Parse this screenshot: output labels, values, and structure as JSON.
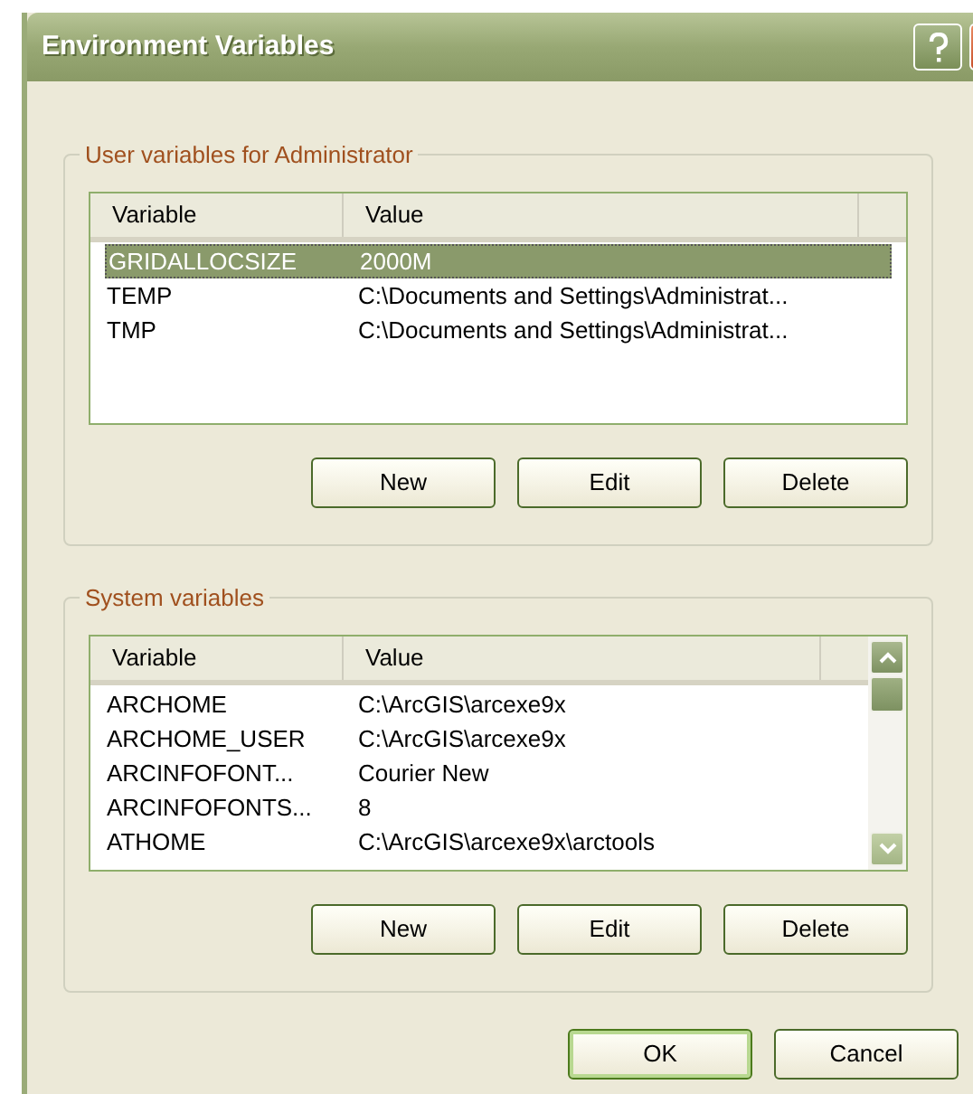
{
  "window": {
    "title": "Environment Variables"
  },
  "user_variables": {
    "label": "User variables for Administrator",
    "columns": [
      "Variable",
      "Value"
    ],
    "rows": [
      {
        "variable": "GRIDALLOCSIZE",
        "value": "2000M",
        "selected": true
      },
      {
        "variable": "TEMP",
        "value": "C:\\Documents and Settings\\Administrat...",
        "selected": false
      },
      {
        "variable": "TMP",
        "value": "C:\\Documents and Settings\\Administrat...",
        "selected": false
      }
    ],
    "buttons": [
      "New",
      "Edit",
      "Delete"
    ]
  },
  "system_variables": {
    "label": "System variables",
    "columns": [
      "Variable",
      "Value"
    ],
    "rows": [
      {
        "variable": "ARCHOME",
        "value": "C:\\ArcGIS\\arcexe9x",
        "selected": false
      },
      {
        "variable": "ARCHOME_USER",
        "value": "C:\\ArcGIS\\arcexe9x",
        "selected": false
      },
      {
        "variable": "ARCINFOFONT...",
        "value": "Courier New",
        "selected": false
      },
      {
        "variable": "ARCINFOFONTS...",
        "value": "8",
        "selected": false
      },
      {
        "variable": "ATHOME",
        "value": "C:\\ArcGIS\\arcexe9x\\arctools",
        "selected": false
      }
    ],
    "buttons": [
      "New",
      "Edit",
      "Delete"
    ]
  },
  "dialog_buttons": [
    {
      "label": "OK",
      "default": true
    },
    {
      "label": "Cancel",
      "default": false
    }
  ]
}
